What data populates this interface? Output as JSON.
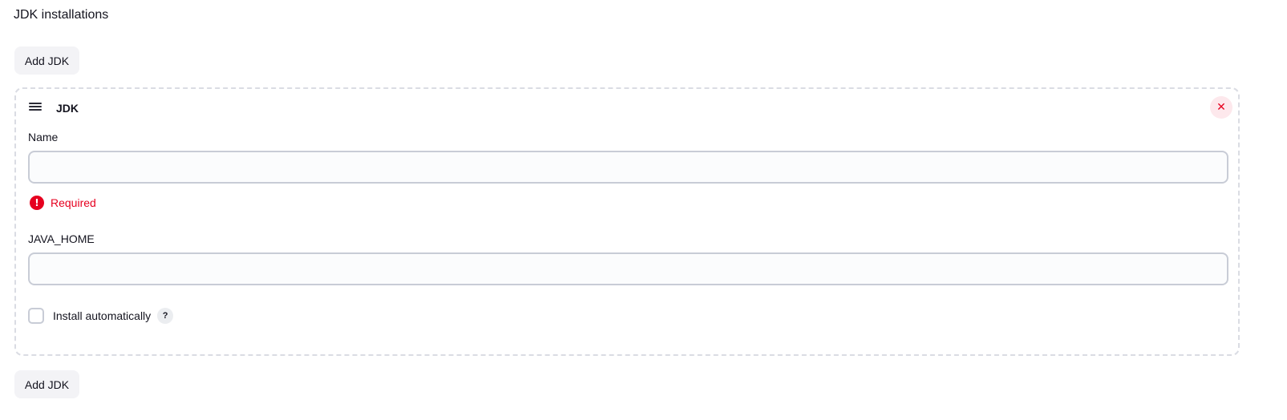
{
  "section": {
    "title": "JDK installations"
  },
  "buttons": {
    "add_jdk_top": "Add JDK",
    "add_jdk_bottom": "Add JDK",
    "delete_symbol": "✕",
    "help_symbol": "?"
  },
  "jdk_chunk": {
    "title": "JDK",
    "name_label": "Name",
    "name_value": "",
    "name_error": "Required",
    "error_icon_symbol": "!",
    "java_home_label": "JAVA_HOME",
    "java_home_value": "",
    "install_auto_label": "Install automatically",
    "install_auto_checked": false
  },
  "colors": {
    "error": "#e6001f",
    "button_bg": "#f3f3f6",
    "border_dashed": "#dadce3",
    "delete_bg": "#fde8ec"
  }
}
